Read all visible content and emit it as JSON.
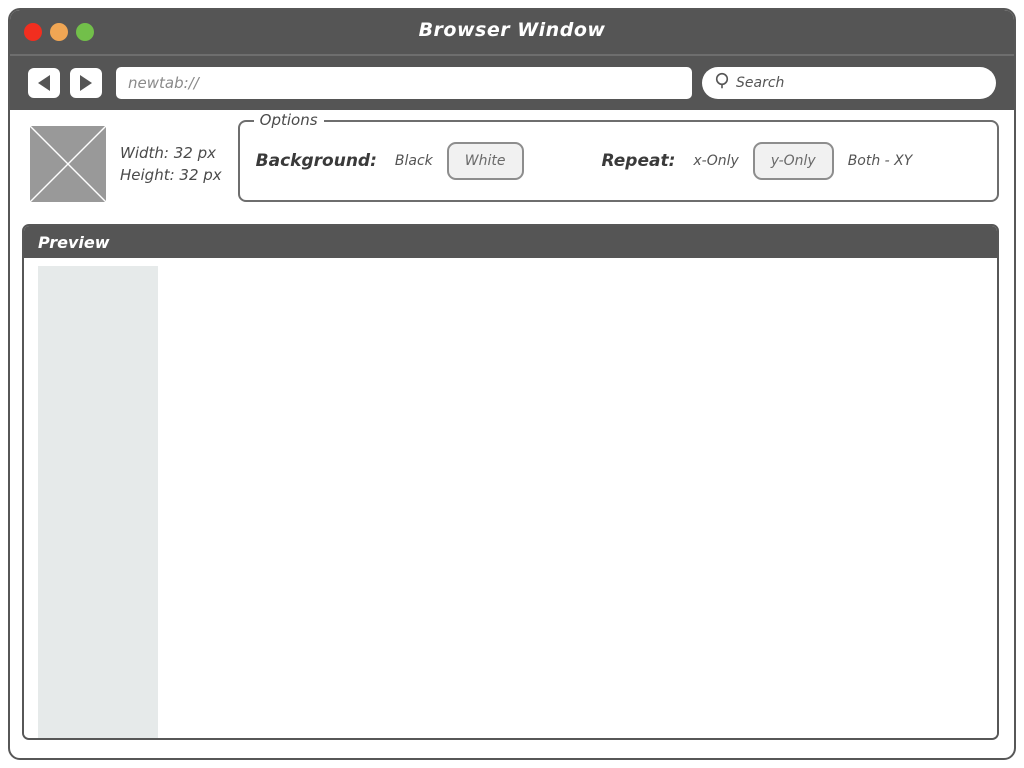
{
  "window": {
    "title": "Browser Window",
    "controls": [
      {
        "name": "close",
        "color": "#f22e1f"
      },
      {
        "name": "minimize",
        "color": "#f0a654"
      },
      {
        "name": "maximize",
        "color": "#72bf4a"
      }
    ]
  },
  "toolbar": {
    "back_icon": "triangle-left",
    "forward_icon": "triangle-right",
    "address_value": "newtab://",
    "search_icon": "magnifier",
    "search_label": "Search"
  },
  "image_info": {
    "thumbnail_icon": "image-placeholder",
    "width_text": "Width: 32 px",
    "height_text": "Height: 32 px"
  },
  "options": {
    "legend": "Options",
    "background": {
      "label": "Background:",
      "choices": [
        {
          "label": "Black",
          "selected": false
        },
        {
          "label": "White",
          "selected": true
        }
      ]
    },
    "repeat": {
      "label": "Repeat:",
      "choices": [
        {
          "label": "x-Only",
          "selected": false
        },
        {
          "label": "y-Only",
          "selected": true
        },
        {
          "label": "Both - XY",
          "selected": false
        }
      ]
    }
  },
  "preview": {
    "header": "Preview",
    "tile_fill": "#e6eaea"
  }
}
